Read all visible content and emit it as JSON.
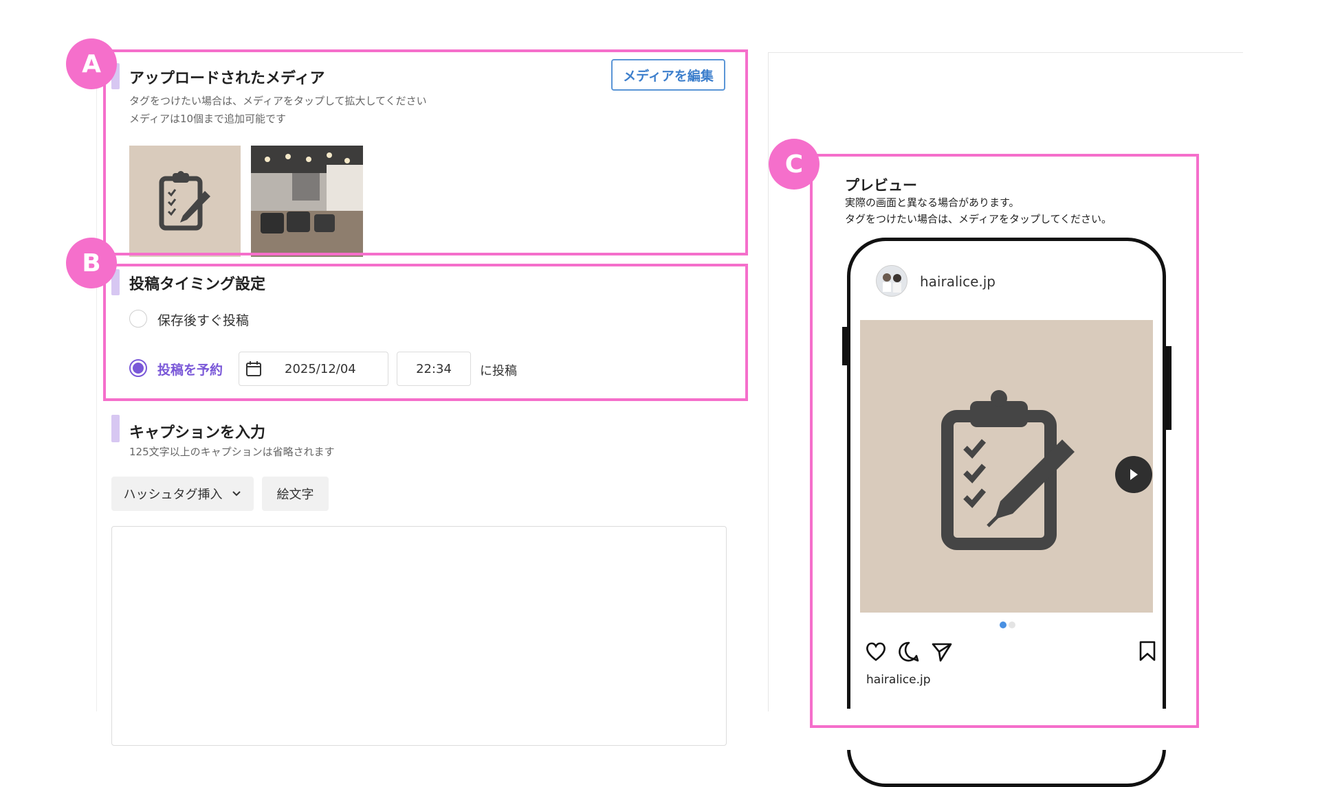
{
  "media_section": {
    "title": "アップロードされたメディア",
    "note_line1": "タグをつけたい場合は、メディアをタップして拡大してください",
    "note_line2": "メディアは10個まで追加可能です",
    "edit_button": "メディアを編集",
    "thumbnails": [
      "clipboard-checklist-icon",
      "salon-interior-photo"
    ]
  },
  "timing_section": {
    "title": "投稿タイミング設定",
    "option_immediate": "保存後すぐ投稿",
    "option_schedule": "投稿を予約",
    "selected": "option_schedule",
    "date": "2025/12/04",
    "time": "22:34",
    "suffix": "に投稿"
  },
  "caption_section": {
    "title": "キャプションを入力",
    "note": "125文字以上のキャプションは省略されます",
    "hashtag_button": "ハッシュタグ挿入",
    "emoji_button": "絵文字",
    "caption_value": ""
  },
  "preview": {
    "title": "プレビュー",
    "note_line1": "実際の画面と異なる場合があります。",
    "note_line2": "タグをつけたい場合は、メディアをタップしてください。",
    "account_name": "hairalice.jp",
    "footer_account": "hairalice.jp",
    "carousel_index": 1,
    "carousel_count": 2
  },
  "annotations": {
    "a": "A",
    "b": "B",
    "c": "C"
  },
  "colors": {
    "highlight": "#f56fcb",
    "accent_purple": "#7a58d8",
    "accent_blue": "#3d7fcc",
    "section_bar": "#d7c7f2",
    "media_beige": "#d9cbbc"
  }
}
